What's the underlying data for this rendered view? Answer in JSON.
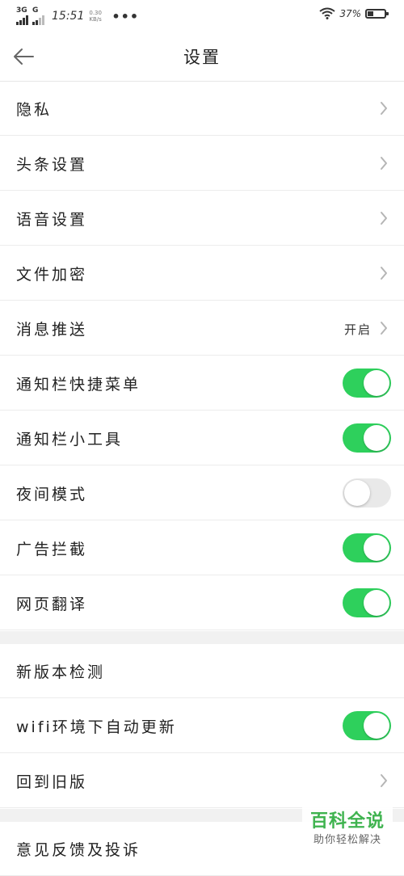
{
  "status_bar": {
    "network_1": "3G",
    "network_2": "G",
    "time": "15:51",
    "speed_value": "0.30",
    "speed_unit": "KB/s",
    "more": "•••",
    "battery_percent": "37%",
    "battery_level": 0.37
  },
  "header": {
    "title": "设置",
    "back_icon": "arrow-left-icon"
  },
  "sections": [
    {
      "rows": [
        {
          "label": "隐私",
          "type": "chevron"
        },
        {
          "label": "头条设置",
          "type": "chevron"
        },
        {
          "label": "语音设置",
          "type": "chevron"
        },
        {
          "label": "文件加密",
          "type": "chevron"
        },
        {
          "label": "消息推送",
          "type": "chevron",
          "value": "开启"
        },
        {
          "label": "通知栏快捷菜单",
          "type": "toggle",
          "on": true
        },
        {
          "label": "通知栏小工具",
          "type": "toggle",
          "on": true
        },
        {
          "label": "夜间模式",
          "type": "toggle",
          "on": false
        },
        {
          "label": "广告拦截",
          "type": "toggle",
          "on": true
        },
        {
          "label": "网页翻译",
          "type": "toggle",
          "on": true
        }
      ]
    },
    {
      "rows": [
        {
          "label": "新版本检测",
          "type": "plain"
        },
        {
          "label": "wifi环境下自动更新",
          "type": "toggle",
          "on": true
        },
        {
          "label": "回到旧版",
          "type": "chevron"
        }
      ]
    },
    {
      "rows": [
        {
          "label": "意见反馈及投诉",
          "type": "plain"
        }
      ]
    }
  ],
  "watermark": {
    "main": "百科全说",
    "sub": "助你轻松解决"
  },
  "colors": {
    "toggle_on": "#2ed05c",
    "toggle_off": "#e9e9e9",
    "watermark_green": "#3fb34f"
  }
}
